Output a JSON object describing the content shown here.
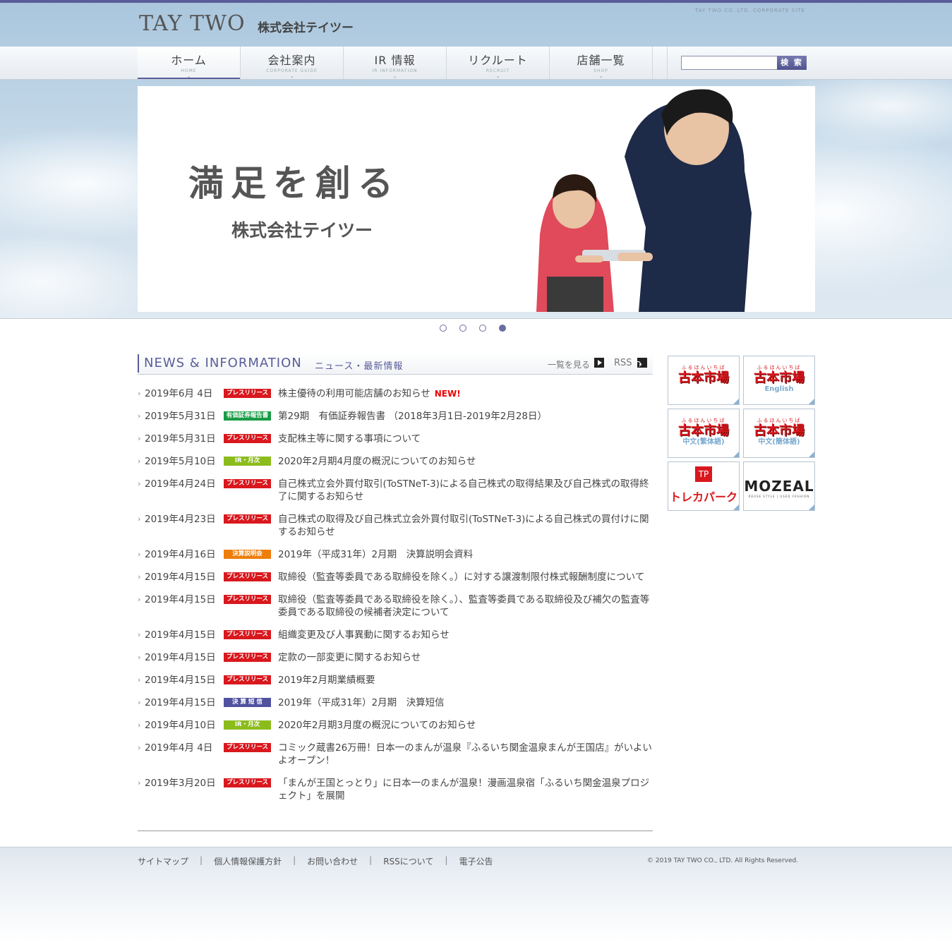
{
  "header": {
    "logo": "TAY TWO",
    "logo_jp": "株式会社テイツー",
    "corporate_site": "TAY TWO CO.,LTD. CORPORATE SITE"
  },
  "nav": [
    {
      "jp": "ホーム",
      "en": "HOME"
    },
    {
      "jp": "会社案内",
      "en": "CORPORATE GUIDE"
    },
    {
      "jp": "IR 情報",
      "en": "IR INFORMATION"
    },
    {
      "jp": "リクルート",
      "en": "RECRUIT"
    },
    {
      "jp": "店舗一覧",
      "en": "SHOP"
    }
  ],
  "search": {
    "placeholder": "",
    "button": "検 索"
  },
  "hero": {
    "tagline": "満足を創る",
    "company": "株式会社テイツー",
    "slides": 4,
    "active_slide": 4
  },
  "news": {
    "title_en": "NEWS & INFORMATION",
    "title_jp": "ニュース・最新情報",
    "list_link": "一覧を見る",
    "rss": "RSS",
    "new_label": "NEW!",
    "items": [
      {
        "date": "2019年6月 4日",
        "badge": "プレスリリース",
        "title": "株主優待の利用可能店舗のお知らせ"
      },
      {
        "date": "2019年5月31日",
        "badge": "有価証券報告書",
        "title": "第29期　有価証券報告書 （2018年3月1日-2019年2月28日）"
      },
      {
        "date": "2019年5月31日",
        "badge": "プレスリリース",
        "title": "支配株主等に関する事項について"
      },
      {
        "date": "2019年5月10日",
        "badge": "IR・月次",
        "title": "2020年2月期4月度の概況についてのお知らせ"
      },
      {
        "date": "2019年4月24日",
        "badge": "プレスリリース",
        "title": "自己株式立会外買付取引(ToSTNeT-3)による自己株式の取得結果及び自己株式の取得終了に関するお知らせ"
      },
      {
        "date": "2019年4月23日",
        "badge": "プレスリリース",
        "title": "自己株式の取得及び自己株式立会外買付取引(ToSTNeT-3)による自己株式の買付けに関するお知らせ"
      },
      {
        "date": "2019年4月16日",
        "badge": "決算説明会",
        "title": "2019年（平成31年）2月期　決算説明会資料"
      },
      {
        "date": "2019年4月15日",
        "badge": "プレスリリース",
        "title": "取締役（監査等委員である取締役を除く。）に対する譲渡制限付株式報酬制度について"
      },
      {
        "date": "2019年4月15日",
        "badge": "プレスリリース",
        "title": "取締役（監査等委員である取締役を除く。）、監査等委員である取締役及び補欠の監査等委員である取締役の候補者決定について"
      },
      {
        "date": "2019年4月15日",
        "badge": "プレスリリース",
        "title": "組織変更及び人事異動に関するお知らせ"
      },
      {
        "date": "2019年4月15日",
        "badge": "プレスリリース",
        "title": "定款の一部変更に関するお知らせ"
      },
      {
        "date": "2019年4月15日",
        "badge": "プレスリリース",
        "title": "2019年2月期業績概要"
      },
      {
        "date": "2019年4月15日",
        "badge": "決 算 短 信",
        "title": "2019年（平成31年）2月期　決算短信"
      },
      {
        "date": "2019年4月10日",
        "badge": "IR・月次",
        "title": "2020年2月期3月度の概況についてのお知らせ"
      },
      {
        "date": "2019年4月 4日",
        "badge": "プレスリリース",
        "title": "コミック蔵書26万冊！日本一のまんが温泉『ふるいち関金温泉まんが王国店』がいよいよオープン！"
      },
      {
        "date": "2019年3月20日",
        "badge": "プレスリリース",
        "title": "「まんが王国とっとり」に日本一のまんが温泉！漫画温泉宿「ふるいち関金温泉プロジェクト」を展開"
      }
    ]
  },
  "banners": [
    {
      "furi": "ふるほんいちば",
      "main": "古本市場",
      "sub": ""
    },
    {
      "furi": "ふるほんいちば",
      "main": "古本市場",
      "sub": "English"
    },
    {
      "furi": "ふるほんいちば",
      "main": "古本市場",
      "sub": "中文(繁体語)"
    },
    {
      "furi": "ふるほんいちば",
      "main": "古本市場",
      "sub": "中文(簡体語)"
    },
    {
      "main": "トレカパーク",
      "box": "TP"
    },
    {
      "main": "MOZEAL",
      "sub": "REUSE STYLE | USED FASHION"
    }
  ],
  "footer": {
    "links": [
      "サイトマップ",
      "個人情報保護方針",
      "お問い合わせ",
      "RSSについて",
      "電子公告"
    ],
    "copyright": "© 2019 TAY TWO CO., LTD. All Rights Reserved."
  },
  "colors": {
    "accent": "#5a5d9a",
    "press": "#d9181e",
    "yuho": "#1a9b45",
    "ir": "#8cbc1c",
    "setsumei": "#ee7d0b",
    "tanshin": "#5151a0"
  }
}
